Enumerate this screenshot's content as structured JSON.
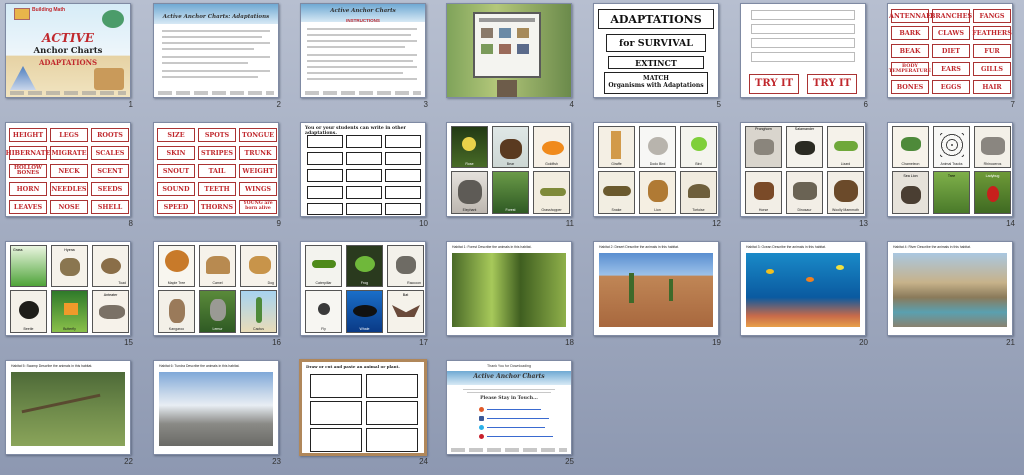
{
  "slides": [
    {
      "num": "1",
      "title_line1": "ACTIVE",
      "title_line2": "Anchor Charts",
      "title_line3": "ADAPTATIONS",
      "badge": "Building Math"
    },
    {
      "num": "2",
      "title": "Active Anchor Charts: Adaptations"
    },
    {
      "num": "3",
      "title": "Active Anchor Charts",
      "subtitle": "INSTRUCTIONS"
    },
    {
      "num": "4"
    },
    {
      "num": "5",
      "t1": "ADAPTATIONS",
      "t2": "for SURVIVAL",
      "t3": "EXTINCT",
      "t4": "MATCH",
      "t5": "Organisms with Adaptations"
    },
    {
      "num": "6",
      "try1": "TRY IT",
      "try2": "TRY IT"
    },
    {
      "num": "7",
      "words": [
        "ANTENNAE",
        "BRANCHES",
        "FANGS",
        "BARK",
        "CLAWS",
        "FEATHERS",
        "BEAK",
        "DIET",
        "FUR",
        "BODY TEMPERATURE",
        "EARS",
        "GILLS",
        "BONES",
        "EGGS",
        "HAIR"
      ]
    },
    {
      "num": "8",
      "words": [
        "HEIGHT",
        "LEGS",
        "ROOTS",
        "HIBERNATE",
        "MIGRATE",
        "SCALES",
        "HOLLOW BONES",
        "NECK",
        "SCENT",
        "HORN",
        "NEEDLES",
        "SEEDS",
        "LEAVES",
        "NOSE",
        "SHELL"
      ]
    },
    {
      "num": "9",
      "words": [
        "SIZE",
        "SPOTS",
        "TONGUE",
        "SKIN",
        "STRIPES",
        "TRUNK",
        "SNOUT",
        "TAIL",
        "WEIGHT",
        "SOUND",
        "TEETH",
        "WINGS",
        "SPEED",
        "THORNS",
        "YOUNG are born alive"
      ]
    },
    {
      "num": "10",
      "title": "You or your students can write in other adaptations."
    },
    {
      "num": "11",
      "labels": [
        "Rose",
        "Bear",
        "Goldfish",
        "Elephant",
        "Forest",
        "Grasshopper"
      ]
    },
    {
      "num": "12",
      "labels": [
        "Giraffe",
        "Dodo Bird",
        "Bird",
        "Snake",
        "Lion",
        "Tortoise"
      ]
    },
    {
      "num": "13",
      "labels": [
        "Pronghorn",
        "Salamander",
        "Lizard",
        "Horse",
        "Dinosaur",
        "Woolly Mammoth"
      ]
    },
    {
      "num": "14",
      "labels": [
        "Chameleon",
        "Animal Tracks",
        "Rhinoceros",
        "Sea Lion",
        "Tree",
        "Ladybug"
      ]
    },
    {
      "num": "15",
      "labels": [
        "Grass",
        "Hyena",
        "Toad",
        "Beetle",
        "Butterfly",
        "Anteater"
      ]
    },
    {
      "num": "16",
      "labels": [
        "Maple Tree",
        "Camel",
        "Dog",
        "Kangaroo",
        "Lemur",
        "Cactus"
      ]
    },
    {
      "num": "17",
      "labels": [
        "Caterpillar",
        "Frog",
        "Raccoon",
        "Fly",
        "Whale",
        "Bat"
      ]
    },
    {
      "num": "18",
      "habitat": "Habitat 1: Forest",
      "question": "Describe the animals in this habitat."
    },
    {
      "num": "19",
      "habitat": "Habitat 2: Desert",
      "question": "Describe the animals in this habitat."
    },
    {
      "num": "20",
      "habitat": "Habitat 3: Ocean",
      "question": "Describe the animals in this habitat."
    },
    {
      "num": "21",
      "habitat": "Habitat 4: River",
      "question": "Describe the animals in this habitat."
    },
    {
      "num": "22",
      "habitat": "Habitat 5: Swamp",
      "question": "Describe the animals in this habitat."
    },
    {
      "num": "23",
      "habitat": "Habitat 6: Tundra",
      "question": "Describe the animals in this habitat."
    },
    {
      "num": "24",
      "title": "Draw or cut and paste an animal or plant."
    },
    {
      "num": "25",
      "line1": "Thank You for Downloading",
      "line2": "Active Anchor Charts",
      "line3": "Please Stay in Touch..."
    }
  ],
  "colors": {
    "card_red": "#c0282d",
    "selected_border": "#b0875a",
    "background": "#9aa4bb"
  }
}
